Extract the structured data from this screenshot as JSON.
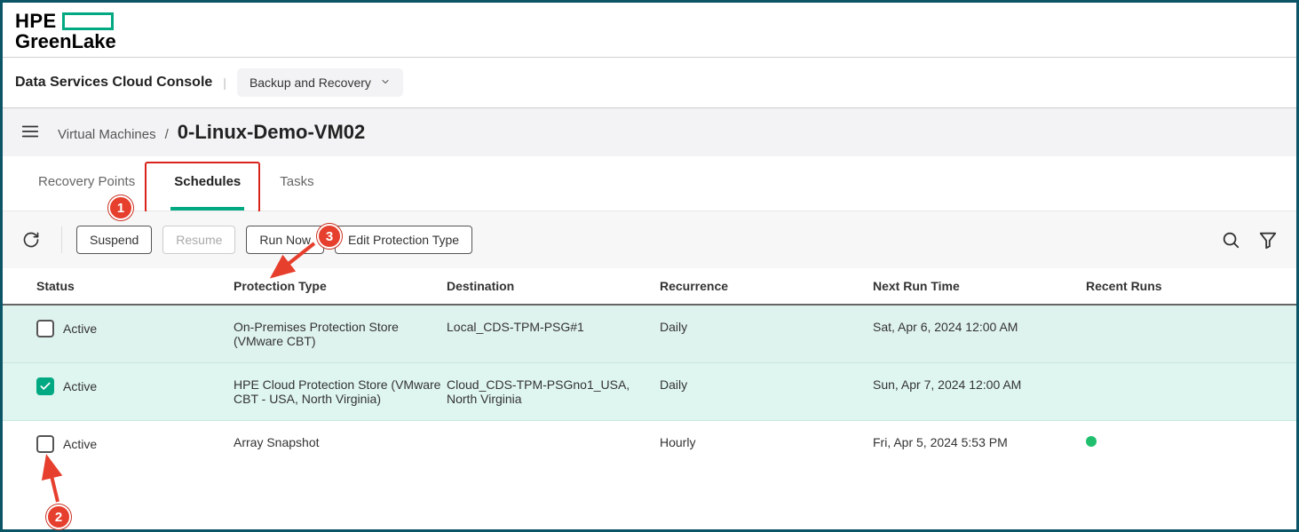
{
  "brand": {
    "line1": "HPE",
    "line2": "GreenLake"
  },
  "console": {
    "title": "Data Services Cloud Console",
    "service": "Backup and Recovery"
  },
  "breadcrumb": {
    "parent": "Virtual Machines",
    "current": "0-Linux-Demo-VM02"
  },
  "tabs": [
    {
      "label": "Recovery Points",
      "active": false
    },
    {
      "label": "Schedules",
      "active": true
    },
    {
      "label": "Tasks",
      "active": false
    }
  ],
  "toolbar": {
    "buttons": {
      "suspend": "Suspend",
      "resume": "Resume",
      "run_now": "Run Now",
      "edit_type": "Edit Protection Type"
    }
  },
  "columns": {
    "status": "Status",
    "ptype": "Protection Type",
    "dest": "Destination",
    "recur": "Recurrence",
    "next": "Next Run Time",
    "recent": "Recent Runs"
  },
  "rows": [
    {
      "checked": false,
      "status": "Active",
      "ptype": "On-Premises Protection Store (VMware CBT)",
      "dest": "Local_CDS-TPM-PSG#1",
      "recur": "Daily",
      "next": "Sat, Apr 6, 2024 12:00 AM",
      "recent": "",
      "highlight": "sel1"
    },
    {
      "checked": true,
      "status": "Active",
      "ptype": "HPE Cloud Protection Store (VMware CBT - USA, North Virginia)",
      "dest": "Cloud_CDS-TPM-PSGno1_USA, North Virginia",
      "recur": "Daily",
      "next": "Sun, Apr 7, 2024 12:00 AM",
      "recent": "",
      "highlight": "sel2"
    },
    {
      "checked": false,
      "status": "Active",
      "ptype": "Array Snapshot",
      "dest": "",
      "recur": "Hourly",
      "next": "Fri, Apr 5, 2024 5:53 PM",
      "recent": "dot",
      "highlight": ""
    }
  ],
  "annotations": {
    "b1": "1",
    "b2": "2",
    "b3": "3"
  }
}
